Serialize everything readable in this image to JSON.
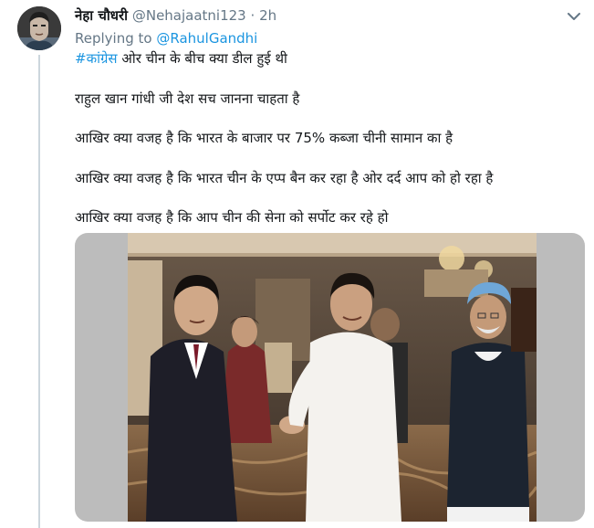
{
  "tweet": {
    "author_name": "नेहा चौधरी",
    "handle": "@Nehajaatni123",
    "separator": "·",
    "time": "2h",
    "replying_prefix": "Replying to",
    "replying_to": "@RahulGandhi",
    "hashtag": "#कांग्रेस",
    "line1_rest": " ओर चीन के बीच क्या डील हुई थी",
    "line2": "राहुल खान गांधी जी देश सच जानना चाहता है",
    "line3": "आखिर क्या वजह है कि भारत के बाजार पर 75% कब्जा चीनी सामान का है",
    "line4": "आखिर क्या वजह है कि भारत चीन के एप्प बैन कर रहा है ओर दर्द आप को हो रहा है",
    "line5": "आखिर क्या वजह है कि आप चीन की सेना को सर्पोट कर रहे हो"
  },
  "icons": {
    "caret": "chevron-down-icon",
    "avatar": "avatar"
  },
  "colors": {
    "link": "#1b95e0",
    "muted": "#657786",
    "text": "#14171a",
    "thread_line": "#ccd6dd"
  }
}
